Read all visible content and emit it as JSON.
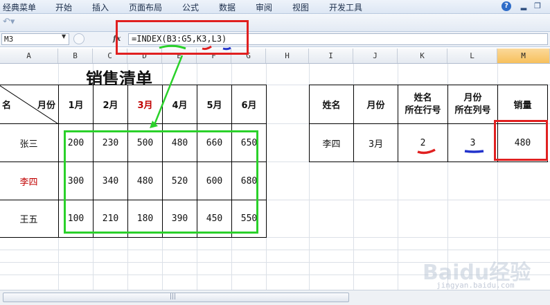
{
  "menu": {
    "items": [
      "经典菜单",
      "开始",
      "插入",
      "页面布局",
      "公式",
      "数据",
      "审阅",
      "视图",
      "开发工具"
    ]
  },
  "formula_bar": {
    "name_box": "M3",
    "fx_label": "fx",
    "formula": "=INDEX(B3:G5,K3,L3)"
  },
  "columns": [
    "A",
    "B",
    "C",
    "D",
    "E",
    "F",
    "G",
    "H",
    "I",
    "J",
    "K",
    "L",
    "M"
  ],
  "selected_column": "M",
  "sales_table": {
    "title": "销售清单",
    "corner_left": "名",
    "corner_right": "月份",
    "months": [
      "1月",
      "2月",
      "3月",
      "4月",
      "5月",
      "6月"
    ],
    "highlight_month": "3月",
    "rows": [
      {
        "name": "张三",
        "values": [
          "200",
          "230",
          "500",
          "480",
          "660",
          "650"
        ]
      },
      {
        "name": "李四",
        "values": [
          "300",
          "340",
          "480",
          "520",
          "600",
          "680"
        ]
      },
      {
        "name": "王五",
        "values": [
          "100",
          "210",
          "180",
          "390",
          "450",
          "550"
        ]
      }
    ]
  },
  "lookup_table": {
    "headers": [
      "姓名",
      "月份",
      "姓名\n所在行号",
      "月份\n所在列号",
      "销量"
    ],
    "values": [
      "李四",
      "3月",
      "2",
      "3",
      "480"
    ]
  },
  "colors": {
    "annotation_red": "#e02020",
    "annotation_green": "#2ad12a",
    "selected_column": "#f7c05c"
  },
  "watermark": {
    "text": "Baidu经验",
    "sub": "jingyan.baidu.com"
  }
}
